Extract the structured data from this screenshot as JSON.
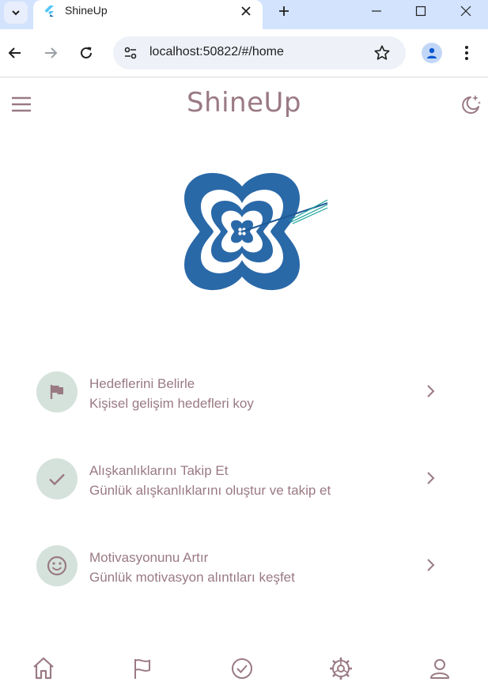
{
  "browser": {
    "tab_title": "ShineUp",
    "url": "localhost:50822/#/home",
    "icons": {
      "tab_search": "chevron-down-icon",
      "favicon": "flutter-icon",
      "tab_close": "close-icon",
      "new_tab": "plus-icon",
      "minimize": "minimize-icon",
      "maximize": "maximize-icon",
      "close_window": "close-icon",
      "back": "back-arrow-icon",
      "forward": "forward-arrow-icon",
      "reload": "reload-icon",
      "site_info": "site-info-icon",
      "bookmark": "star-icon",
      "profile": "person-icon",
      "menu": "kebab-icon"
    }
  },
  "app": {
    "title": "ShineUp",
    "colors": {
      "accent": "#9a7a83",
      "avatar_bg": "#d5e2dc",
      "logo": "#2a69a8"
    },
    "features": [
      {
        "title": "Hedeflerini Belirle",
        "subtitle": "Kişisel gelişim hedefleri koy",
        "icon": "flag-icon"
      },
      {
        "title": "Alışkanlıklarını Takip Et",
        "subtitle": "Günlük alışkanlıklarını oluştur ve takip et",
        "icon": "check-icon"
      },
      {
        "title": "Motivasyonunu Artır",
        "subtitle": "Günlük motivasyon alıntıları keşfet",
        "icon": "smiley-icon"
      }
    ],
    "bottom_nav": [
      {
        "icon": "home-icon"
      },
      {
        "icon": "flag-outline-icon"
      },
      {
        "icon": "check-circle-icon"
      },
      {
        "icon": "settings-icon"
      },
      {
        "icon": "person-icon"
      }
    ]
  }
}
